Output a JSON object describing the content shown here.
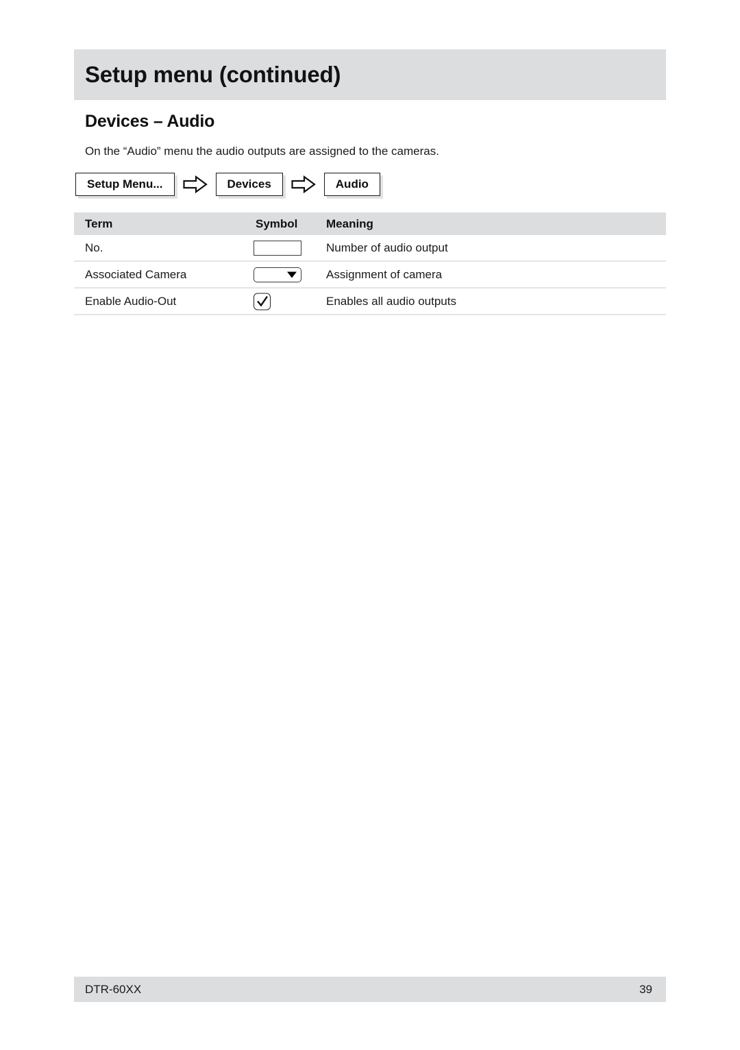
{
  "page": {
    "chapter_title": "Setup menu (continued)",
    "section_heading": "Devices – Audio",
    "intro_text": "On the “Audio” menu the audio outputs are assigned to the cameras."
  },
  "breadcrumb": {
    "items": [
      {
        "label": "Setup Menu...",
        "icon": "menu-box"
      },
      {
        "label": "Devices",
        "icon": "menu-box"
      },
      {
        "label": "Audio",
        "icon": "menu-box"
      }
    ],
    "separator_icon": "arrow-right-outline-icon"
  },
  "table": {
    "headers": {
      "term": "Term",
      "symbol": "Symbol",
      "meaning": "Meaning"
    },
    "rows": [
      {
        "term": "No.",
        "symbol_icon": "text-input-box-icon",
        "meaning": "Number of audio output"
      },
      {
        "term": "Associated Camera",
        "symbol_icon": "dropdown-select-icon",
        "meaning": "Assignment of camera"
      },
      {
        "term": "Enable Audio-Out",
        "symbol_icon": "checkbox-checked-icon",
        "meaning": "Enables all audio outputs"
      }
    ]
  },
  "footer": {
    "model": "DTR-60XX",
    "page_number": "39"
  },
  "colors": {
    "band_gray": "#dcdddf",
    "row_divider": "#e4e4e6",
    "text": "#1a1a1a",
    "page_background": "#ffffff"
  }
}
